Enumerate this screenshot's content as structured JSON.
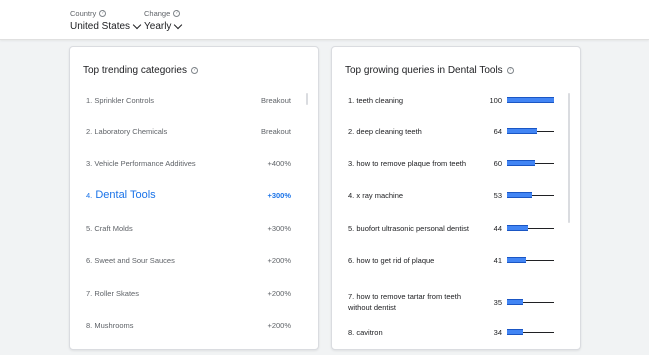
{
  "filters": {
    "country": {
      "label": "Country",
      "value": "United States"
    },
    "change": {
      "label": "Change",
      "value": "Yearly"
    }
  },
  "left_card": {
    "title": "Top trending categories",
    "items": [
      {
        "rank": "1.",
        "name": "Sprinkler Controls",
        "value": "Breakout"
      },
      {
        "rank": "2.",
        "name": "Laboratory Chemicals",
        "value": "Breakout"
      },
      {
        "rank": "3.",
        "name": "Vehicle Performance Additives",
        "value": "+400%"
      },
      {
        "rank": "4.",
        "name": "Dental Tools",
        "value": "+300%"
      },
      {
        "rank": "5.",
        "name": "Craft Molds",
        "value": "+300%"
      },
      {
        "rank": "6.",
        "name": "Sweet and Sour Sauces",
        "value": "+200%"
      },
      {
        "rank": "7.",
        "name": "Roller Skates",
        "value": "+200%"
      },
      {
        "rank": "8.",
        "name": "Mushrooms",
        "value": "+200%"
      }
    ]
  },
  "right_card": {
    "title": "Top growing queries in Dental Tools",
    "items": [
      {
        "rank": "1.",
        "name": "teeth cleaning",
        "value": "100",
        "score": 100
      },
      {
        "rank": "2.",
        "name": "deep cleaning teeth",
        "value": "64",
        "score": 64
      },
      {
        "rank": "3.",
        "name": "how to remove plaque from teeth",
        "value": "60",
        "score": 60
      },
      {
        "rank": "4.",
        "name": "x ray machine",
        "value": "53",
        "score": 53
      },
      {
        "rank": "5.",
        "name": "buofort ultrasonic personal dentist",
        "value": "44",
        "score": 44
      },
      {
        "rank": "6.",
        "name": "how to get rid of plaque",
        "value": "41",
        "score": 41
      },
      {
        "rank": "7.",
        "name": "how to remove tartar from teeth without dentist",
        "value": "35",
        "score": 35
      },
      {
        "rank": "8.",
        "name": "cavitron",
        "value": "34",
        "score": 34
      }
    ]
  },
  "colors": {
    "accent": "#1a73e8",
    "bar": "#4285f4"
  }
}
